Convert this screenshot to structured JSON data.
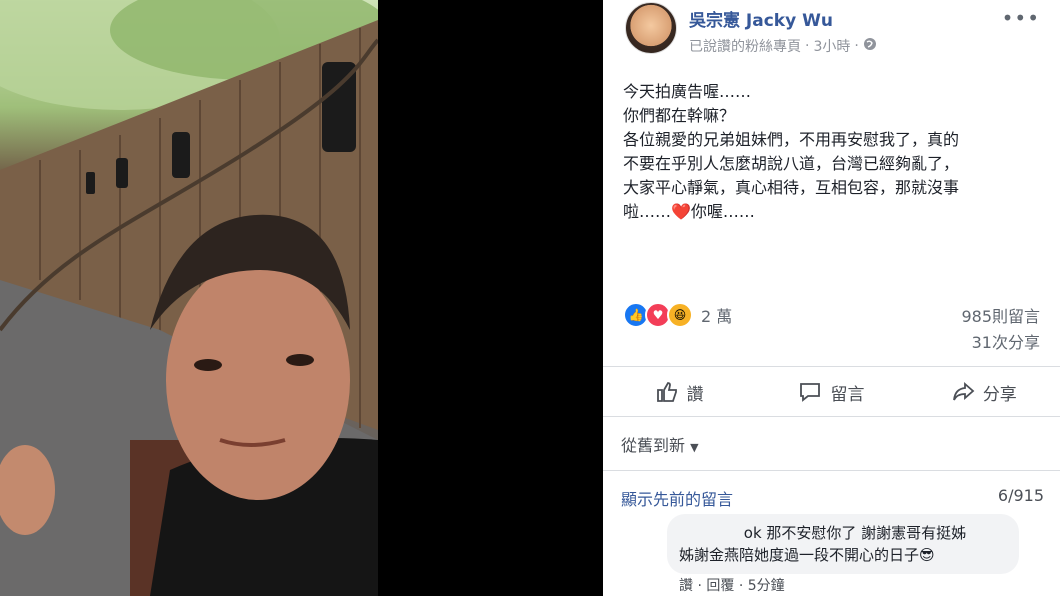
{
  "post": {
    "author": "吳宗憲 Jacky Wu",
    "subtitle": "已說讚的粉絲專頁",
    "separator": "·",
    "time": "3小時",
    "visibility_icon": "globe-icon",
    "more_label": "•••",
    "text": "今天拍廣告喔……\n你們都在幹嘛？\n各位親愛的兄弟姐妹們，不用再安慰我了，真的\n不要在乎別人怎麼胡說八道，台灣已經夠亂了，\n大家平心靜氣，真心相待，互相包容，那就沒事\n啦……❤️你喔……"
  },
  "stats": {
    "reactions_count": "2 萬",
    "reaction_icons": [
      "like-icon",
      "love-icon",
      "haha-icon"
    ],
    "comments": "985則留言",
    "shares": "31次分享"
  },
  "actions": {
    "like": "讚",
    "comment": "留言",
    "share": "分享"
  },
  "comments_section": {
    "sort_label": "從舊到新",
    "previous_label": "顯示先前的留言",
    "counter": "6/915",
    "comment": {
      "text": "ok 那不安慰你了 謝謝憲哥有挺姊\n姊謝金燕陪她度過一段不開心的日子😎",
      "like": "讚",
      "sep": "·",
      "reply": "回覆",
      "time": "5分鐘"
    }
  },
  "colors": {
    "link": "#365899",
    "text": "#1d2129",
    "muted": "#90949c",
    "like_blue": "#1877f2",
    "love_red": "#f33e58",
    "haha_yellow": "#f7b125"
  }
}
